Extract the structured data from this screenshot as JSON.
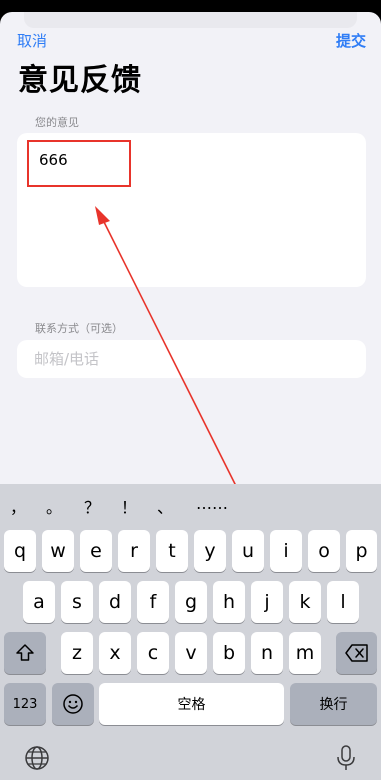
{
  "nav": {
    "cancel_label": "取消",
    "submit_label": "提交"
  },
  "page": {
    "title": "意见反馈"
  },
  "opinion": {
    "label": "您的意见",
    "value": "666"
  },
  "contact": {
    "label": "联系方式（可选）",
    "placeholder": "邮箱/电话"
  },
  "colors": {
    "accent": "#2f7df6",
    "annotation": "#e8342b"
  },
  "keyboard": {
    "punctuation": [
      "，",
      "。",
      "？",
      "！",
      "、",
      "……"
    ],
    "row1": [
      "q",
      "w",
      "e",
      "r",
      "t",
      "y",
      "u",
      "i",
      "o",
      "p"
    ],
    "row2": [
      "a",
      "s",
      "d",
      "f",
      "g",
      "h",
      "j",
      "k",
      "l"
    ],
    "row3": [
      "z",
      "x",
      "c",
      "v",
      "b",
      "n",
      "m"
    ],
    "numbers_label": "123",
    "space_label": "空格",
    "return_label": "换行",
    "icons": [
      "shift-icon",
      "backspace-icon",
      "emoji-icon",
      "globe-icon",
      "microphone-icon"
    ]
  }
}
